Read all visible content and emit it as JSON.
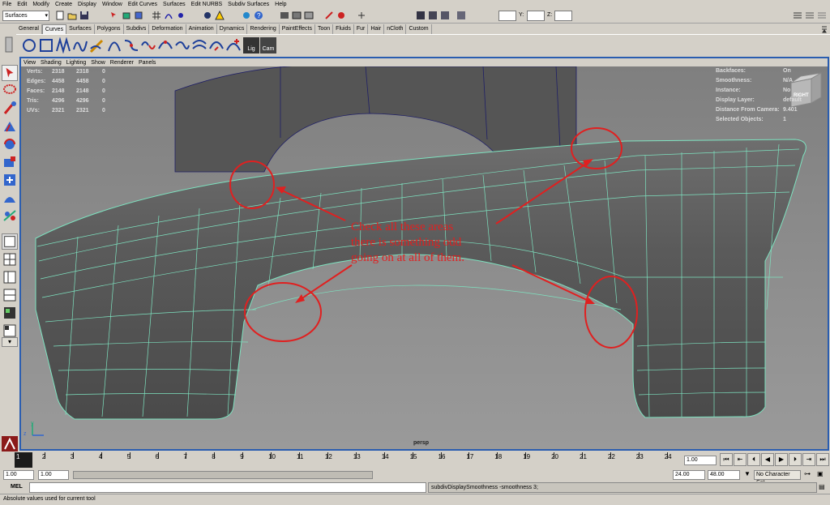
{
  "menu": [
    "File",
    "Edit",
    "Modify",
    "Create",
    "Display",
    "Window",
    "Edit Curves",
    "Surfaces",
    "Edit NURBS",
    "Subdiv Surfaces",
    "Help"
  ],
  "status_line": {
    "mode": "Surfaces",
    "x_label": "X:",
    "y_label": "Y:",
    "z_label": "Z:"
  },
  "shelf_tabs": [
    "General",
    "Curves",
    "Surfaces",
    "Polygons",
    "Subdivs",
    "Deformation",
    "Animation",
    "Dynamics",
    "Rendering",
    "PaintEffects",
    "Toon",
    "Fluids",
    "Fur",
    "Hair",
    "nCloth",
    "Custom"
  ],
  "active_shelf_tab": "Curves",
  "shelf_labels": {
    "lights": "Lig",
    "cameras": "Cam"
  },
  "panel_menu": [
    "View",
    "Shading",
    "Lighting",
    "Show",
    "Renderer",
    "Panels"
  ],
  "hud_left": [
    {
      "label": "Verts:",
      "a": "2318",
      "b": "2318",
      "c": "0"
    },
    {
      "label": "Edges:",
      "a": "4458",
      "b": "4458",
      "c": "0"
    },
    {
      "label": "Faces:",
      "a": "2148",
      "b": "2148",
      "c": "0"
    },
    {
      "label": "Tris:",
      "a": "4296",
      "b": "4296",
      "c": "0"
    },
    {
      "label": "UVs:",
      "a": "2321",
      "b": "2321",
      "c": "0"
    }
  ],
  "hud_right": [
    {
      "label": "Backfaces:",
      "value": "On"
    },
    {
      "label": "Smoothness:",
      "value": "N/A"
    },
    {
      "label": "Instance:",
      "value": "No"
    },
    {
      "label": "Display Layer:",
      "value": "default"
    },
    {
      "label": "Distance From Camera:",
      "value": "9.401"
    },
    {
      "label": "Selected Objects:",
      "value": "1"
    }
  ],
  "view_cube_label": "RIGHT",
  "camera_name": "persp",
  "axis_labels": {
    "y": "y",
    "z": "z"
  },
  "annotation": [
    "Check all these areas",
    "there is something odd",
    "going on at all of them."
  ],
  "timeline": {
    "ticks": [
      "1",
      "2",
      "3",
      "4",
      "5",
      "6",
      "7",
      "8",
      "9",
      "10",
      "11",
      "12",
      "13",
      "14",
      "15",
      "16",
      "17",
      "18",
      "19",
      "20",
      "21",
      "22",
      "23",
      "24"
    ],
    "current_frame": "1.00"
  },
  "range": {
    "start": "1.00",
    "start_inner": "1.00",
    "end_inner": "24.00",
    "end": "48.00",
    "character_set": "No Character Set"
  },
  "command": {
    "label": "MEL",
    "feedback": "subdivDisplaySmoothness -smoothness 3;"
  },
  "help_line": "Absolute values used for current tool",
  "colors": {
    "viewport_bg": "#8c8c8c",
    "wire": "#7ee3c0",
    "annotation": "#e02020",
    "panel_border": "#2a5db0"
  }
}
